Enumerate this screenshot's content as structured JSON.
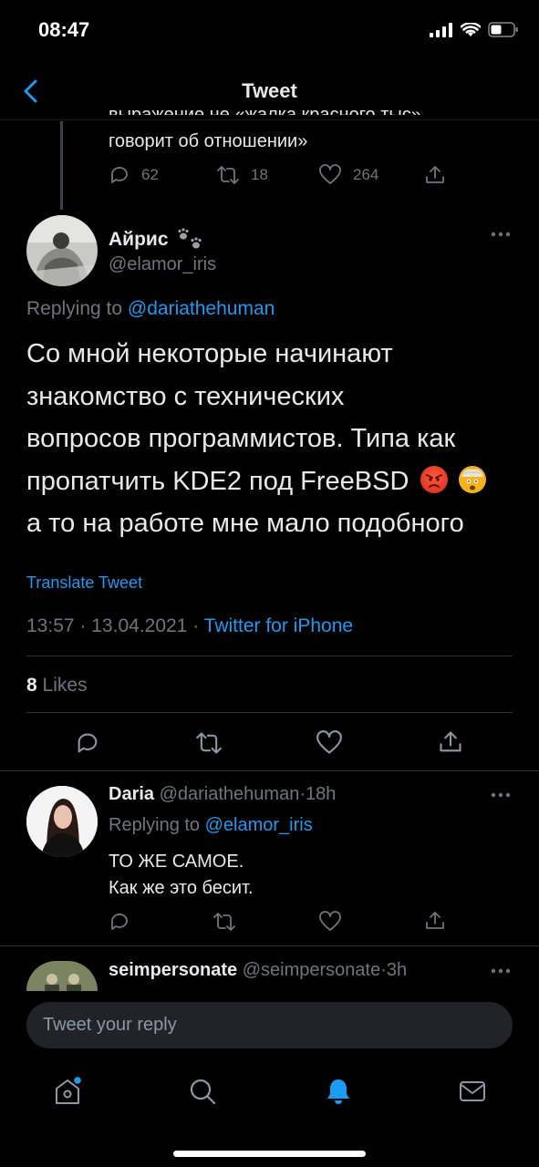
{
  "status_bar": {
    "time": "08:47"
  },
  "nav": {
    "title": "Tweet"
  },
  "previous_tweet": {
    "cut_text": "выражение не «жалка красного тыс»",
    "text": "говорит об отношении»",
    "replies": "62",
    "retweets": "18",
    "likes": "264"
  },
  "main_tweet": {
    "name": "Айрис",
    "handle": "@elamor_iris",
    "replying_prefix": "Replying to",
    "replying_to": "@dariathehuman",
    "text_lines": [
      "Со мной некоторые начинают",
      "знакомство с технических",
      "вопросов программистов. Типа как",
      "пропатчить KDE2 под FreeBSD",
      "а то на работе мне мало подобного"
    ],
    "emojis": [
      "angry-face",
      "exploding-head"
    ],
    "translate": "Translate Tweet",
    "time": "13:57",
    "date": "13.04.2021",
    "source": "Twitter for iPhone",
    "likes_count": "8",
    "likes_label": "Likes"
  },
  "reply_tweet": {
    "name": "Daria",
    "handle": "@dariathehuman",
    "age": "18h",
    "replying_prefix": "Replying to",
    "replying_to": "@elamor_iris",
    "line1": "ТО ЖЕ САМОЕ.",
    "line2": "Как же это бесит."
  },
  "third_tweet": {
    "name": "seimpersonate",
    "handle": "@seimpersonate",
    "age": "3h"
  },
  "composer": {
    "placeholder": "Tweet your reply"
  },
  "tabs": [
    "home-icon",
    "search-icon",
    "notifications-icon",
    "messages-icon"
  ],
  "colors": {
    "accent": "#1d9bf0",
    "muted": "#6e767d",
    "background": "#000000"
  }
}
